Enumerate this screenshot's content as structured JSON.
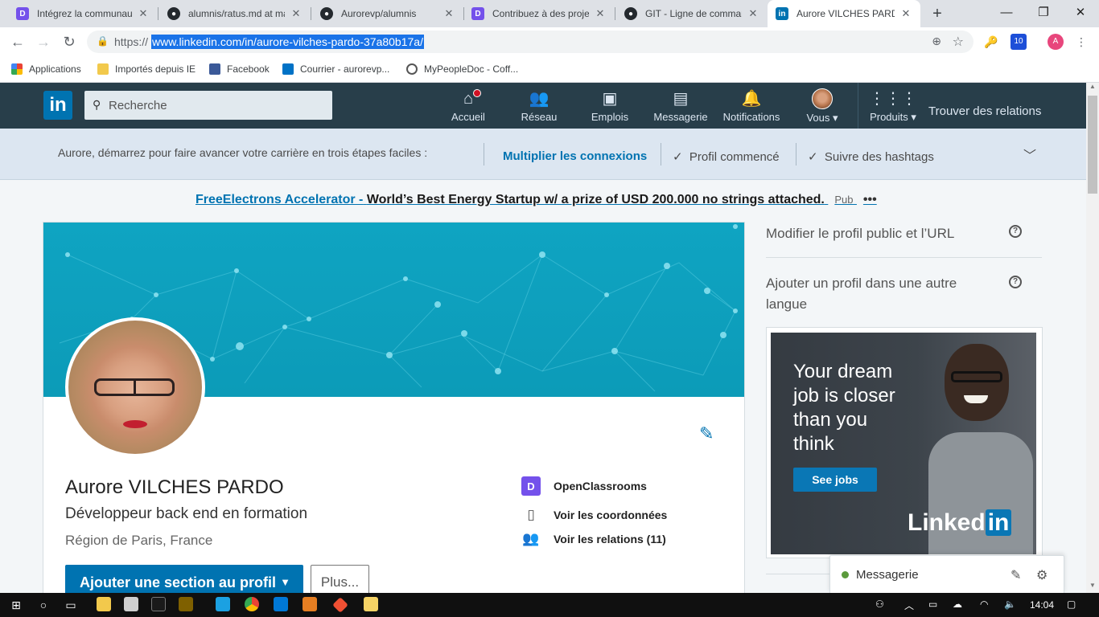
{
  "browser": {
    "tabs": [
      {
        "label": "Intégrez la communauté",
        "favicon": "openclassrooms-icon",
        "color": "#7451eb",
        "active": false
      },
      {
        "label": "alumnis/ratus.md at ma",
        "favicon": "github-icon",
        "color": "#24292e",
        "active": false
      },
      {
        "label": "Aurorevp/alumnis",
        "favicon": "github-icon",
        "color": "#24292e",
        "active": false
      },
      {
        "label": "Contribuez à des projet",
        "favicon": "openclassrooms-icon",
        "color": "#7451eb",
        "active": false
      },
      {
        "label": "GIT - Ligne de command",
        "favicon": "github-icon",
        "color": "#24292e",
        "active": false
      },
      {
        "label": "Aurore VILCHES PARDO",
        "favicon": "linkedin-icon",
        "color": "#0073b1",
        "active": true
      }
    ],
    "new_tab": "+",
    "window_controls": {
      "minimize": "—",
      "maximize": "❐",
      "close": "✕"
    },
    "nav": {
      "back": "←",
      "forward": "→",
      "reload": "↻"
    },
    "omnibox": {
      "protocol": "https://",
      "url": "www.linkedin.com/in/aurore-vilches-pardo-37a80b17a/"
    },
    "extension_badge": "10",
    "profile_initial": "A",
    "bookmarks": [
      {
        "label": "Applications",
        "icon": "apps-grid-icon"
      },
      {
        "label": "Importés depuis IE",
        "icon": "folder-icon"
      },
      {
        "label": "Facebook",
        "icon": "facebook-icon"
      },
      {
        "label": "Courrier - aurorevp...",
        "icon": "outlook-icon"
      },
      {
        "label": "MyPeopleDoc - Coff...",
        "icon": "mypeopledoc-icon"
      }
    ]
  },
  "linkedin": {
    "logo": "in",
    "search": {
      "placeholder": "Recherche"
    },
    "nav": [
      {
        "label": "Accueil",
        "icon": "home-icon"
      },
      {
        "label": "Réseau",
        "icon": "network-icon"
      },
      {
        "label": "Emplois",
        "icon": "briefcase-icon"
      },
      {
        "label": "Messagerie",
        "icon": "messaging-icon"
      },
      {
        "label": "Notifications",
        "icon": "bell-icon"
      },
      {
        "label": "Vous",
        "icon": "avatar"
      },
      {
        "label": "Produits",
        "icon": "grid-icon"
      }
    ],
    "find_relations": "Trouver des relations",
    "guidance": {
      "intro": "Aurore, démarrez pour faire avancer votre carrière en trois étapes faciles :",
      "steps": [
        {
          "label": "Multiplier les connexions",
          "done": false
        },
        {
          "label": "Profil commencé",
          "done": true
        },
        {
          "label": "Suivre des hashtags",
          "done": true
        }
      ]
    },
    "top_ad": {
      "advertiser": "FreeElectrons Accelerator -",
      "text": "World’s Best Energy Startup w/ a prize of USD 200.000 no strings attached.",
      "tag": "Pub",
      "more": "•••"
    },
    "profile": {
      "name": "Aurore VILCHES PARDO",
      "headline": "Développeur back end en formation",
      "location": "Région de Paris, France",
      "side_links": [
        {
          "label": "OpenClassrooms",
          "icon": "openclassrooms-icon"
        },
        {
          "label": "Voir les coordonnées",
          "icon": "contact-card-icon"
        },
        {
          "label": "Voir les relations (11)",
          "icon": "people-icon"
        }
      ],
      "primary_button": "Ajouter une section au profil",
      "secondary_button": "Plus..."
    },
    "right_rail": {
      "links": [
        "Modifier le profil public et l’URL",
        "Ajouter un profil dans une autre langue"
      ],
      "ad": {
        "headline": "Your dream job is closer than you think",
        "cta": "See jobs",
        "brand_text": "Linked",
        "brand_in": "in"
      }
    },
    "messaging_dock": {
      "label": "Messagerie"
    }
  },
  "taskbar": {
    "clock": "14:04"
  },
  "colors": {
    "linkedin_blue": "#0073b1",
    "nav_bg": "#283e4a",
    "guide_bg": "#dce6f1",
    "banner": "#0fa4c2"
  }
}
